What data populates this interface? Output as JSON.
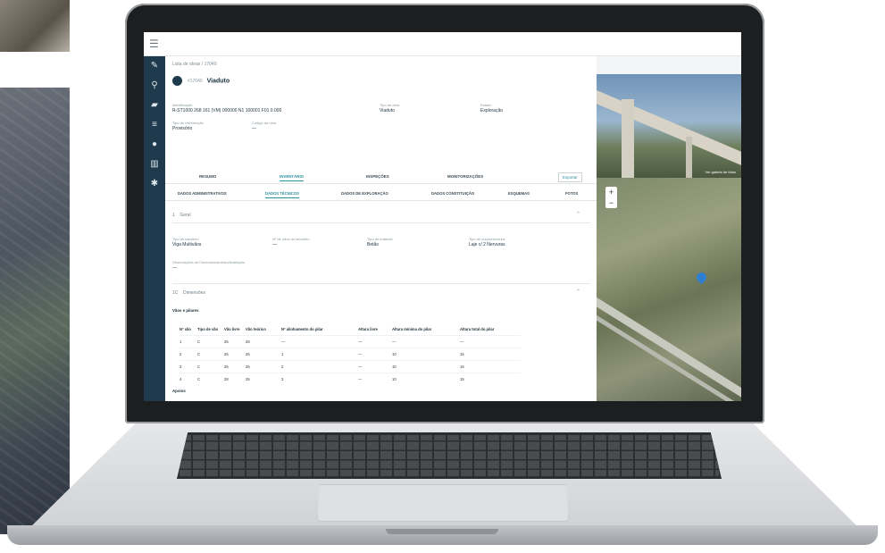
{
  "breadcrumb": "Lista de obras  /  17040",
  "asset": {
    "code": "#17040",
    "name": "Viaduto"
  },
  "fields": [
    {
      "label": "Identificação",
      "value": "R-ST1000 268 161 (VM) 000000 N1 100001 F01 0.000"
    },
    {
      "label": "Tipo de obra",
      "value": "Viaduto"
    },
    {
      "label": "Estado",
      "value": "Exploração"
    },
    {
      "label": "Tipo de intervenção",
      "value": "Provisório"
    },
    {
      "label": "Código da obra",
      "value": "—"
    }
  ],
  "tabs_primary": [
    "RESUMO",
    "INVENTÁRIO",
    "INSPEÇÕES",
    "MONITORIZAÇÕES"
  ],
  "tabs_primary_active": 1,
  "action_button": "Exportar",
  "tabs_secondary": [
    "DADOS ADMINISTRATIVOS",
    "DADOS TÉCNICOS",
    "DADOS DE EXPLORAÇÃO",
    "DADOS CONSTITUIÇÃO",
    "ESQUEMAS",
    "FOTOS"
  ],
  "tabs_secondary_active": 1,
  "section1": {
    "number": "1",
    "title": "Geral"
  },
  "section1_fields": [
    {
      "label": "Tipo de tabuleiro",
      "value": "Viga Multivãos"
    },
    {
      "label": "Nº de vãos do tabuleiro",
      "value": "—"
    },
    {
      "label": "Tipo de material",
      "value": "Betão"
    },
    {
      "label": "Tipo de superestrutura",
      "value": "Laje c/ 2 Nervuras"
    },
    {
      "label": "Observações de Dimensionamento/Avaliação",
      "value": "—"
    }
  ],
  "section2": {
    "number": "1C",
    "title": "Dimensões"
  },
  "subsection": "Vãos e pilares",
  "table": {
    "headers": [
      "Nº vão",
      "Tipo de vão",
      "Vão livre",
      "Vão teórico",
      "Nº alinhamento do pilar",
      "Altura livre",
      "Altura mínima do pilar",
      "Altura total do pilar"
    ],
    "rows": [
      [
        "1",
        "C",
        "25",
        "28",
        "—",
        "—",
        "—",
        "—"
      ],
      [
        "2",
        "C",
        "25",
        "25",
        "1",
        "—",
        "10",
        "15"
      ],
      [
        "3",
        "C",
        "25",
        "25",
        "2",
        "—",
        "10",
        "15"
      ],
      [
        "4",
        "C",
        "28",
        "25",
        "3",
        "—",
        "10",
        "15"
      ]
    ]
  },
  "footer_label": "Apoios",
  "map": {
    "photo_caption": "Ver galeria de fotos",
    "zoom_in": "+",
    "zoom_out": "−"
  },
  "sidebar_icons": [
    "edit-icon",
    "search-icon",
    "truck-icon",
    "list-icon",
    "user-icon",
    "map-icon",
    "gear-icon"
  ]
}
